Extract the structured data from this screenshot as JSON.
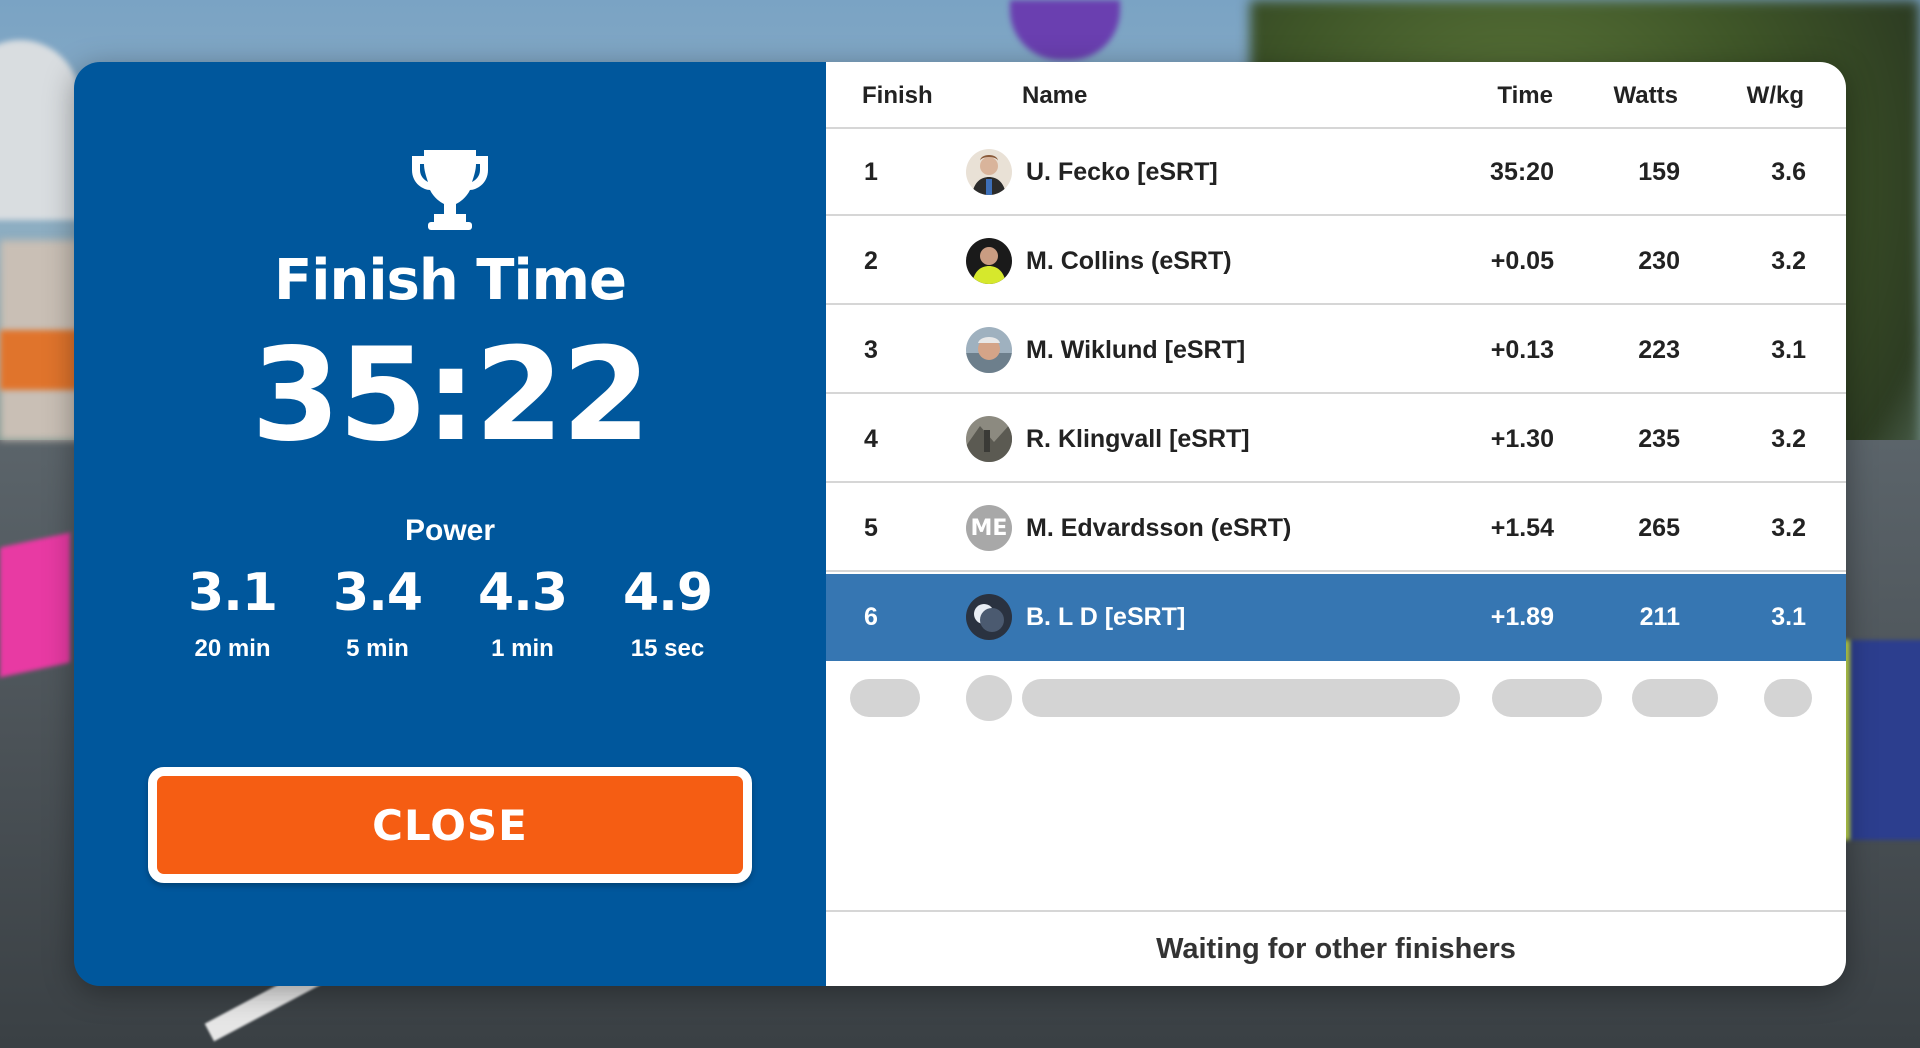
{
  "summary": {
    "finish_label": "Finish Time",
    "finish_time": "35:22",
    "power_label": "Power",
    "power": [
      {
        "value": "3.1",
        "duration": "20 min"
      },
      {
        "value": "3.4",
        "duration": "5 min"
      },
      {
        "value": "4.3",
        "duration": "1 min"
      },
      {
        "value": "4.9",
        "duration": "15 sec"
      }
    ],
    "close_label": "CLOSE"
  },
  "results": {
    "columns": {
      "finish": "Finish",
      "name": "Name",
      "time": "Time",
      "watts": "Watts",
      "wkg": "W/kg"
    },
    "rows": [
      {
        "pos": "1",
        "name": "U. Fecko [eSRT]",
        "time": "35:20",
        "watts": "159",
        "wkg": "3.6",
        "avatar": "photo"
      },
      {
        "pos": "2",
        "name": "M. Collins (eSRT)",
        "time": "+0.05",
        "watts": "230",
        "wkg": "3.2",
        "avatar": "photo"
      },
      {
        "pos": "3",
        "name": "M. Wiklund [eSRT]",
        "time": "+0.13",
        "watts": "223",
        "wkg": "3.1",
        "avatar": "photo"
      },
      {
        "pos": "4",
        "name": "R. Klingvall [eSRT]",
        "time": "+1.30",
        "watts": "235",
        "wkg": "3.2",
        "avatar": "photo"
      },
      {
        "pos": "5",
        "name": "M. Edvardsson (eSRT)",
        "time": "+1.54",
        "watts": "265",
        "wkg": "3.2",
        "avatar": "initials",
        "initials": "ME"
      },
      {
        "pos": "6",
        "name": "B. L D [eSRT]",
        "time": "+1.89",
        "watts": "211",
        "wkg": "3.1",
        "avatar": "photo",
        "highlight": true
      }
    ],
    "footer": "Waiting for other finishers"
  },
  "colors": {
    "panel_blue": "#00579c",
    "highlight_row": "#3676b2",
    "close_orange": "#f55d13"
  }
}
